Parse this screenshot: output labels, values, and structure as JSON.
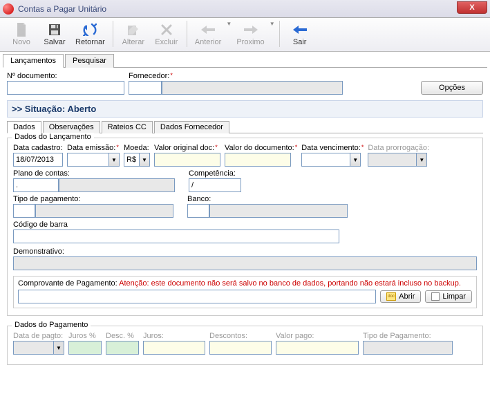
{
  "window": {
    "title": "Contas a Pagar Unitário",
    "close": "X"
  },
  "toolbar": {
    "novo": "Novo",
    "salvar": "Salvar",
    "retornar": "Retornar",
    "alterar": "Alterar",
    "excluir": "Excluir",
    "anterior": "Anterior",
    "proximo": "Proximo",
    "sair": "Sair"
  },
  "tabs": {
    "lancamentos": "Lançamentos",
    "pesquisar": "Pesquisar"
  },
  "doc": {
    "num_label": "Nº documento:",
    "num_value": "",
    "fornecedor_label": "Fornecedor:",
    "fornecedor_value": "",
    "opcoes": "Opções"
  },
  "status": ">>  Situação: Aberto",
  "subtabs": {
    "dados": "Dados",
    "obs": "Observações",
    "rateios": "Rateios CC",
    "dados_forn": "Dados Fornecedor"
  },
  "lanc": {
    "group_title": "Dados do Lançamento",
    "data_cadastro_label": "Data cadastro:",
    "data_cadastro_value": "18/07/2013",
    "data_emissao_label": "Data emissão:",
    "data_emissao_value": "",
    "moeda_label": "Moeda:",
    "moeda_value": "R$",
    "valor_orig_label": "Valor original doc:",
    "valor_orig_value": "",
    "valor_doc_label": "Valor do documento:",
    "valor_doc_value": "",
    "data_venc_label": "Data vencimento:",
    "data_venc_value": "",
    "data_prorr_label": "Data prorrogação:",
    "data_prorr_value": "",
    "plano_label": "Plano de contas:",
    "plano_code": ".",
    "plano_desc": "",
    "comp_label": "Competência:",
    "comp_value": "/",
    "tipo_pag_label": "Tipo de pagamento:",
    "tipo_pag_code": "",
    "tipo_pag_desc": "",
    "banco_label": "Banco:",
    "banco_code": "",
    "banco_desc": "",
    "codigo_barra_label": "Código de barra",
    "codigo_barra_value": "",
    "demonstrativo_label": "Demonstrativo:",
    "demonstrativo_value": "",
    "comprovante_label": "Comprovante de Pagamento: ",
    "comprovante_warning": "Atenção: este documento não será salvo no banco de dados, portando não estará incluso no backup.",
    "comprovante_value": "",
    "abrir": "Abrir",
    "limpar": "Limpar"
  },
  "pag": {
    "group_title": "Dados do Pagamento",
    "data_pagto_label": "Data de pagto:",
    "juros_pct_label": "Juros %",
    "desc_pct_label": "Desc. %",
    "juros_label": "Juros:",
    "descontos_label": "Descontos:",
    "valor_pago_label": "Valor pago:",
    "tipo_pagamento_label": "Tipo de Pagamento:"
  }
}
